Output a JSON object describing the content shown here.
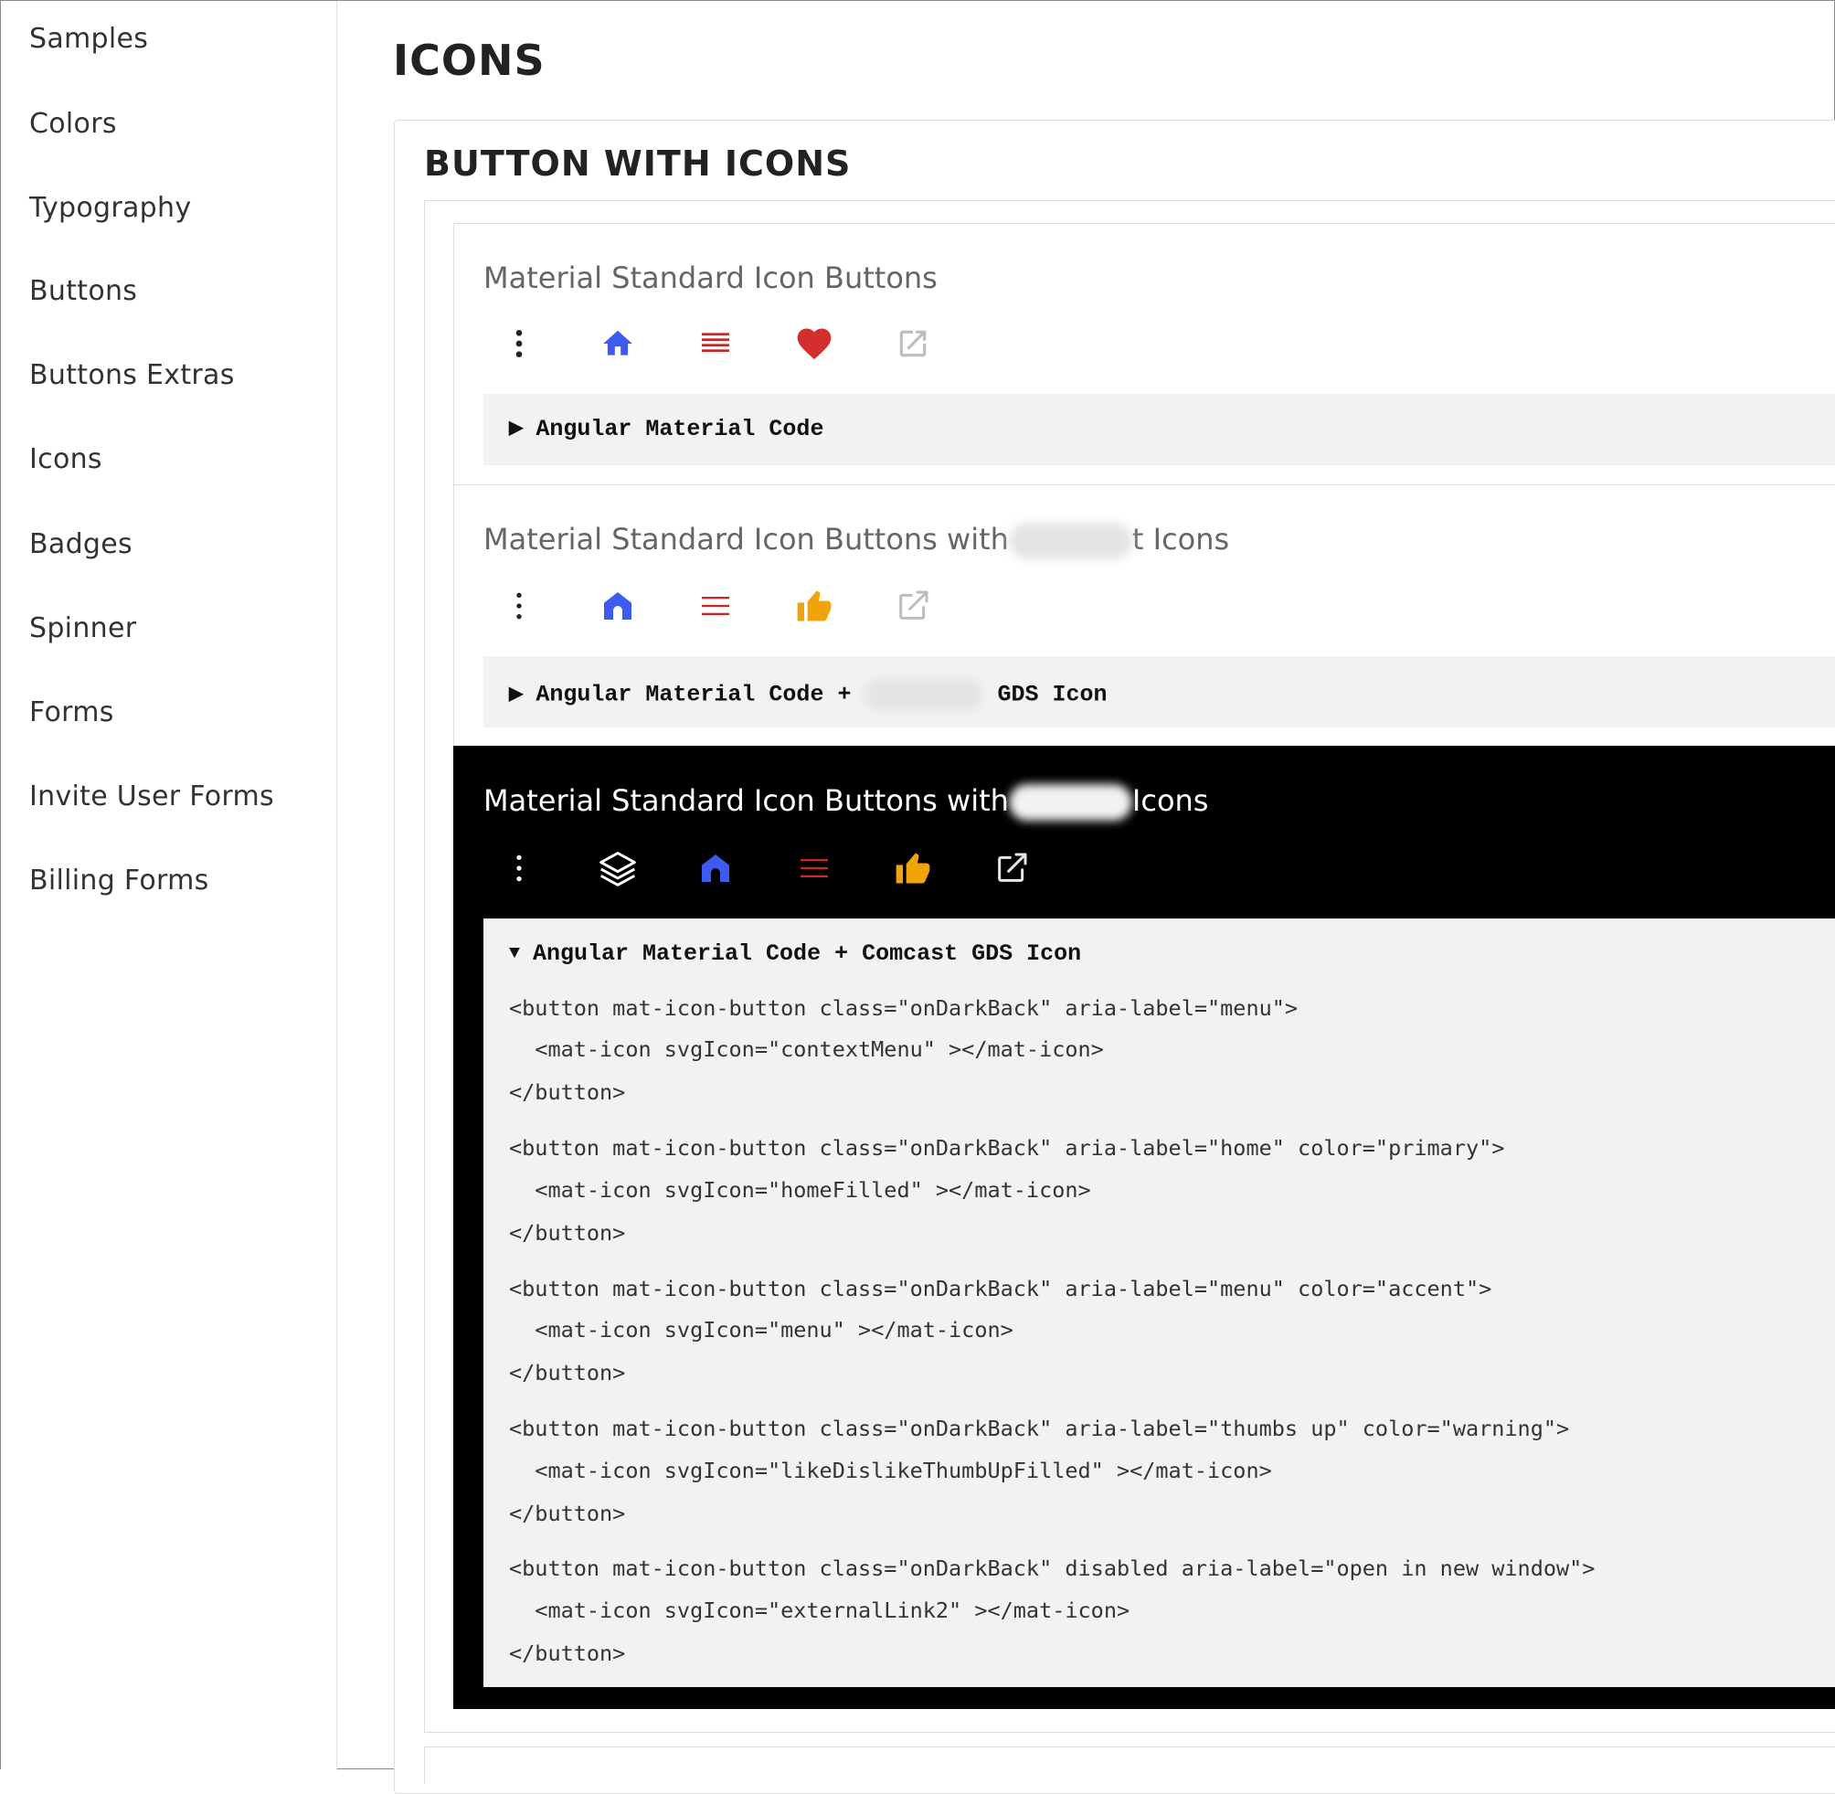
{
  "sidebar": {
    "items": [
      {
        "label": "Samples"
      },
      {
        "label": "Colors"
      },
      {
        "label": "Typography"
      },
      {
        "label": "Buttons"
      },
      {
        "label": "Buttons Extras"
      },
      {
        "label": "Icons"
      },
      {
        "label": "Badges"
      },
      {
        "label": "Spinner"
      },
      {
        "label": "Forms"
      },
      {
        "label": "Invite User Forms"
      },
      {
        "label": "Billing Forms"
      }
    ]
  },
  "page": {
    "title": "ICONS",
    "section_title": "BUTTON WITH ICONS"
  },
  "examples": [
    {
      "title": "Material Standard Icon Buttons",
      "icons": [
        "more-vertical-icon",
        "home-icon",
        "menu-icon",
        "favorite-heart-icon",
        "open-in-new-icon"
      ],
      "code_summary": "Angular Material Code"
    },
    {
      "title_before": "Material Standard Icon Buttons with",
      "title_after": "t Icons",
      "icons": [
        "more-vertical-icon",
        "home-icon",
        "menu-icon",
        "thumbs-up-icon",
        "open-in-new-icon"
      ],
      "code_summary_before": "Angular Material Code +",
      "code_summary_after": "GDS Icon"
    },
    {
      "title_before": "Material Standard Icon Buttons with",
      "title_after": "Icons",
      "icons": [
        "more-vertical-icon",
        "layers-icon",
        "home-icon",
        "menu-icon",
        "thumbs-up-icon",
        "open-in-new-icon"
      ],
      "code_summary": "Angular Material Code + Comcast GDS Icon",
      "code_lines": [
        "<button mat-icon-button class=\"onDarkBack\" aria-label=\"menu\">",
        "  <mat-icon svgIcon=\"contextMenu\" ></mat-icon>",
        "</button>",
        "<button mat-icon-button class=\"onDarkBack\" aria-label=\"home\" color=\"primary\">",
        "  <mat-icon svgIcon=\"homeFilled\" ></mat-icon>",
        "</button>",
        "<button mat-icon-button class=\"onDarkBack\" aria-label=\"menu\" color=\"accent\">",
        "  <mat-icon svgIcon=\"menu\" ></mat-icon>",
        "</button>",
        "<button mat-icon-button class=\"onDarkBack\" aria-label=\"thumbs up\" color=\"warning\">",
        "  <mat-icon svgIcon=\"likeDislikeThumbUpFilled\" ></mat-icon>",
        "</button>",
        "<button mat-icon-button class=\"onDarkBack\" disabled aria-label=\"open in new window\">",
        "  <mat-icon svgIcon=\"externalLink2\" ></mat-icon>",
        "</button>"
      ]
    }
  ],
  "colors": {
    "primary": "#3d5af1",
    "accent": "#c62828",
    "warn": "#d32f2f",
    "warning": "#f0a30a",
    "disabled": "#bdbdbd"
  }
}
